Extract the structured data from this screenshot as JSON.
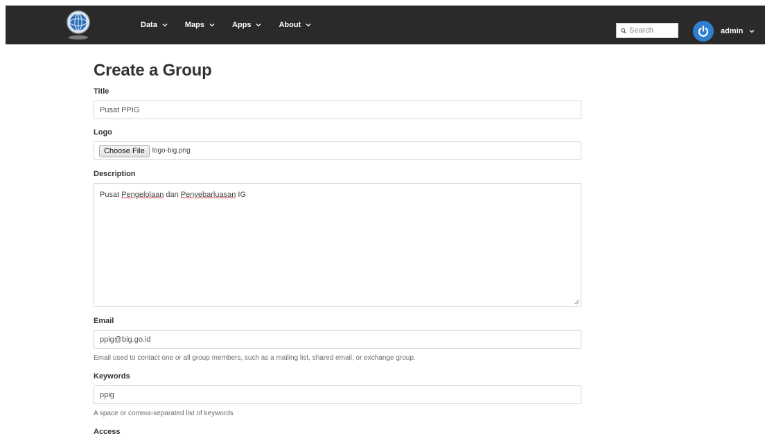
{
  "nav": {
    "items": [
      {
        "label": "Data"
      },
      {
        "label": "Maps"
      },
      {
        "label": "Apps"
      },
      {
        "label": "About"
      }
    ]
  },
  "search": {
    "placeholder": "Search"
  },
  "user": {
    "name": "admin"
  },
  "page": {
    "title": "Create a Group"
  },
  "form": {
    "title_label": "Title",
    "title_value": "Pusat PPIG",
    "logo_label": "Logo",
    "choose_file_label": "Choose File",
    "file_name": "logo-big.png",
    "description_label": "Description",
    "description_parts": [
      "Pusat ",
      "Pengelolaan",
      " dan ",
      "Penyebarluasan",
      " IG"
    ],
    "email_label": "Email",
    "email_value": "ppig@big.go.id",
    "email_help": "Email used to contact one or all group members, such as a mailing list, shared email, or exchange group.",
    "keywords_label": "Keywords",
    "keywords_value": "ppig",
    "keywords_help": "A space or comma-separated list of keywords",
    "access_label": "Access"
  },
  "colors": {
    "topbar": "#2a2a2a",
    "avatar": "#2f7fd0"
  },
  "icons": {
    "logo": "globe-logo-icon",
    "search": "search-icon",
    "user": "power-icon",
    "chevron": "chevron-down-icon"
  }
}
